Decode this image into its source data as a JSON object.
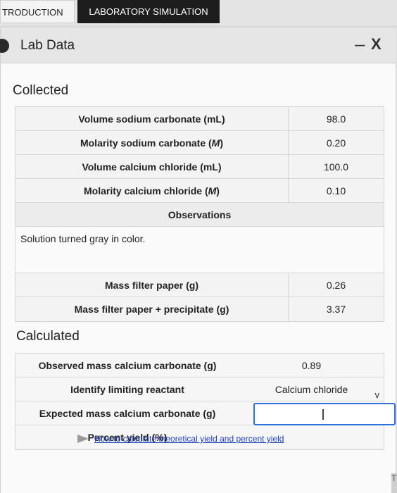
{
  "tabs": {
    "introduction": "TRODUCTION",
    "lab_simulation": "LABORATORY SIMULATION"
  },
  "panel": {
    "title": "Lab Data",
    "minimize": "–",
    "close": "X"
  },
  "collected": {
    "heading": "Collected",
    "rows": [
      {
        "label_pre": "Volume sodium carbonate (mL)",
        "label_em": "",
        "label_post": "",
        "value": "98.0"
      },
      {
        "label_pre": "Molarity sodium carbonate (",
        "label_em": "M",
        "label_post": ")",
        "value": "0.20"
      },
      {
        "label_pre": "Volume calcium chloride (mL)",
        "label_em": "",
        "label_post": "",
        "value": "100.0"
      },
      {
        "label_pre": "Molarity calcium chloride (",
        "label_em": "M",
        "label_post": ")",
        "value": "0.10"
      }
    ],
    "observations_heading": "Observations",
    "observations_text": "Solution turned gray in color.",
    "mass_rows": [
      {
        "label": "Mass filter paper (g)",
        "value": "0.26"
      },
      {
        "label": "Mass filter paper + precipitate (g)",
        "value": "3.37"
      }
    ]
  },
  "calculated": {
    "heading": "Calculated",
    "observed_mass": {
      "label": "Observed mass calcium carbonate (g)",
      "value": "0.89"
    },
    "limiting_reactant": {
      "label": "Identify limiting reactant",
      "value": "Calcium chloride",
      "caret": "v"
    },
    "expected_mass": {
      "label": "Expected mass calcium carbonate (g)",
      "value": ""
    },
    "percent_yield": {
      "label": "Percent yield (%)",
      "value": ""
    }
  },
  "help_link": "How to calculate theoretical yield and percent yield",
  "side_tab": "T",
  "colors": {
    "active_tab": "#1d1d1d",
    "input_border": "#2f6fdb",
    "link": "#1f3fb8"
  }
}
